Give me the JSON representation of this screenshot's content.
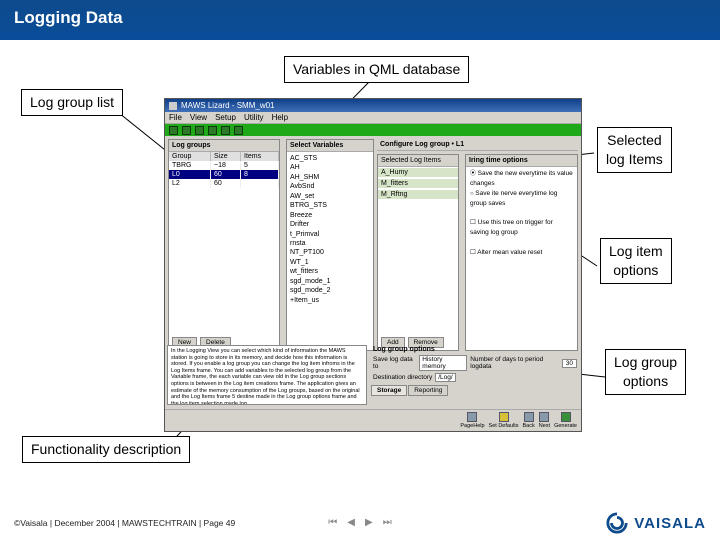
{
  "header": {
    "title": "Logging Data"
  },
  "callouts": {
    "log_group_list": "Log group list",
    "variables_db": "Variables in QML database",
    "selected_items_l1": "Selected",
    "selected_items_l2": "log Items",
    "log_item_opt_l1": "Log item",
    "log_item_opt_l2": " options",
    "log_group_opt_l1": "Log group",
    "log_group_opt_l2": " options",
    "functionality": "Functionality description"
  },
  "app": {
    "title": "MAWS Lizard - SMM_w01",
    "menu": [
      "File",
      "View",
      "Setup",
      "Utility",
      "Help"
    ],
    "panels": {
      "left_title": "Log groups",
      "left_cols": [
        "Group",
        "Size",
        "Items"
      ],
      "left_rows": [
        {
          "g": "TBRG",
          "s": "~18",
          "i": "5"
        },
        {
          "g": "L0",
          "s": "60",
          "i": "8"
        },
        {
          "g": "L2",
          "s": "60",
          "i": ""
        }
      ],
      "mid_title": "Select Variables",
      "variables": [
        "AC_STS",
        "AH",
        "AH_SHM",
        "AvbSnd",
        "AW_set",
        "BTRG_STS",
        "Breeze",
        "Drifter",
        "t_Primval",
        "rnsta",
        "NT_PT100",
        "WT_1",
        "wt_fitters",
        "sgd_mode_1",
        "sgd_mode_2",
        "+Item_us"
      ],
      "right_title": "Configure Log group • L1",
      "right_sub": "Selected Log Items",
      "selected_items": [
        "A_Humy",
        "M_fitters",
        "M_Rftng"
      ],
      "rt_head": "Iring time options",
      "rt_opts": [
        {
          "text": "Save the new everytime its value changes",
          "on": true
        },
        {
          "text": "Save ite nerve everytime log group saves",
          "on": false
        },
        {
          "text": "Use this tree on trigger for saving log group",
          "chk": true
        },
        {
          "text": "Alter mean value reset",
          "chk": true
        }
      ]
    },
    "btns": {
      "new": "New",
      "delete": "Delete",
      "add": "Add",
      "remove": "Remove"
    },
    "lgo": {
      "head": "Log group options",
      "row1_label": "Save log data to",
      "row1_value": "History memory",
      "row1b_label": "Number of days to period logdata",
      "row1b_value": "30",
      "row2_label": "Destination directory",
      "row2_value": "/Log/",
      "tab1": "Storage",
      "tab2": "Reporting"
    },
    "desc_text": "In the Logging View you can select which kind of information the MAWS station is going to store in its memory, and decide how this information is stored.\n\nIf you enable a log group you can change the log item infroms in the Log Items frame. You can add variables to the selected log group from the Variable frame, the each variable can view old in the Log group sections options is between in the Log item creations frame.\n\nThe application gives an estimate of the memory consumption of the Log groups, based on the original and the Log Items frame 5 destine made in the Log group options frame and the log item selection made log",
    "bottom_btns": [
      "PageHelp",
      "Set Defaults",
      "Back",
      "Next",
      "Generate"
    ]
  },
  "footer": {
    "copyright": "©Vaisala | December 2004 | MAWSTECHTRAIN | Page 49",
    "logo": "VAISALA"
  }
}
